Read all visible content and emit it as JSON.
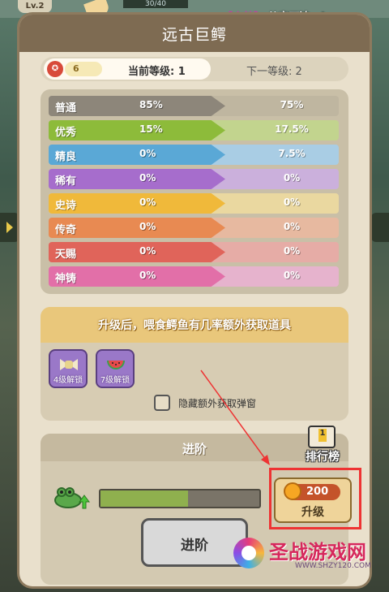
{
  "top": {
    "level_badge": "Lv.2",
    "counter": "30/40"
  },
  "chat": {
    "name": "【小梦】",
    "message": "从容不迫，!"
  },
  "title": "远古巨鳄",
  "level": {
    "token_count": "6",
    "current": "当前等级: 1",
    "next": "下一等级: 2"
  },
  "rates": [
    {
      "name": "普通",
      "current": "85%",
      "next": "75%",
      "bg": "#bfb6a0",
      "fg": "#8d867a"
    },
    {
      "name": "优秀",
      "current": "15%",
      "next": "17.5%",
      "bg": "#c2d48e",
      "fg": "#8dbb3a"
    },
    {
      "name": "精良",
      "current": "0%",
      "next": "7.5%",
      "bg": "#a9cde4",
      "fg": "#5aa8d6"
    },
    {
      "name": "稀有",
      "current": "0%",
      "next": "0%",
      "bg": "#cbb0dc",
      "fg": "#a66dcc"
    },
    {
      "name": "史诗",
      "current": "0%",
      "next": "0%",
      "bg": "#ead8a0",
      "fg": "#f0b93a"
    },
    {
      "name": "传奇",
      "current": "0%",
      "next": "0%",
      "bg": "#e7b9a0",
      "fg": "#e88a52"
    },
    {
      "name": "天赐",
      "current": "0%",
      "next": "0%",
      "bg": "#e6aca6",
      "fg": "#e0645a"
    },
    {
      "name": "神铸",
      "current": "0%",
      "next": "0%",
      "bg": "#e6b3cd",
      "fg": "#e26fa8"
    }
  ],
  "bonus": {
    "header": "升级后，喂食鳄鱼有几率额外获取道具",
    "items": [
      {
        "label": "4级解锁",
        "icon": "candy-icon"
      },
      {
        "label": "7级解锁",
        "icon": "watermelon-icon"
      }
    ],
    "hide_popup_label": "隐藏额外获取弹窗"
  },
  "advance": {
    "title": "进阶",
    "rank_label": "排行榜",
    "rank_number": "1",
    "progress": 0.55,
    "upgrade_cost": "200",
    "upgrade_label": "升级",
    "advance_button": "进阶"
  },
  "watermark": {
    "text": "圣战游戏网",
    "url": "WWW.SHZY120.COM"
  }
}
